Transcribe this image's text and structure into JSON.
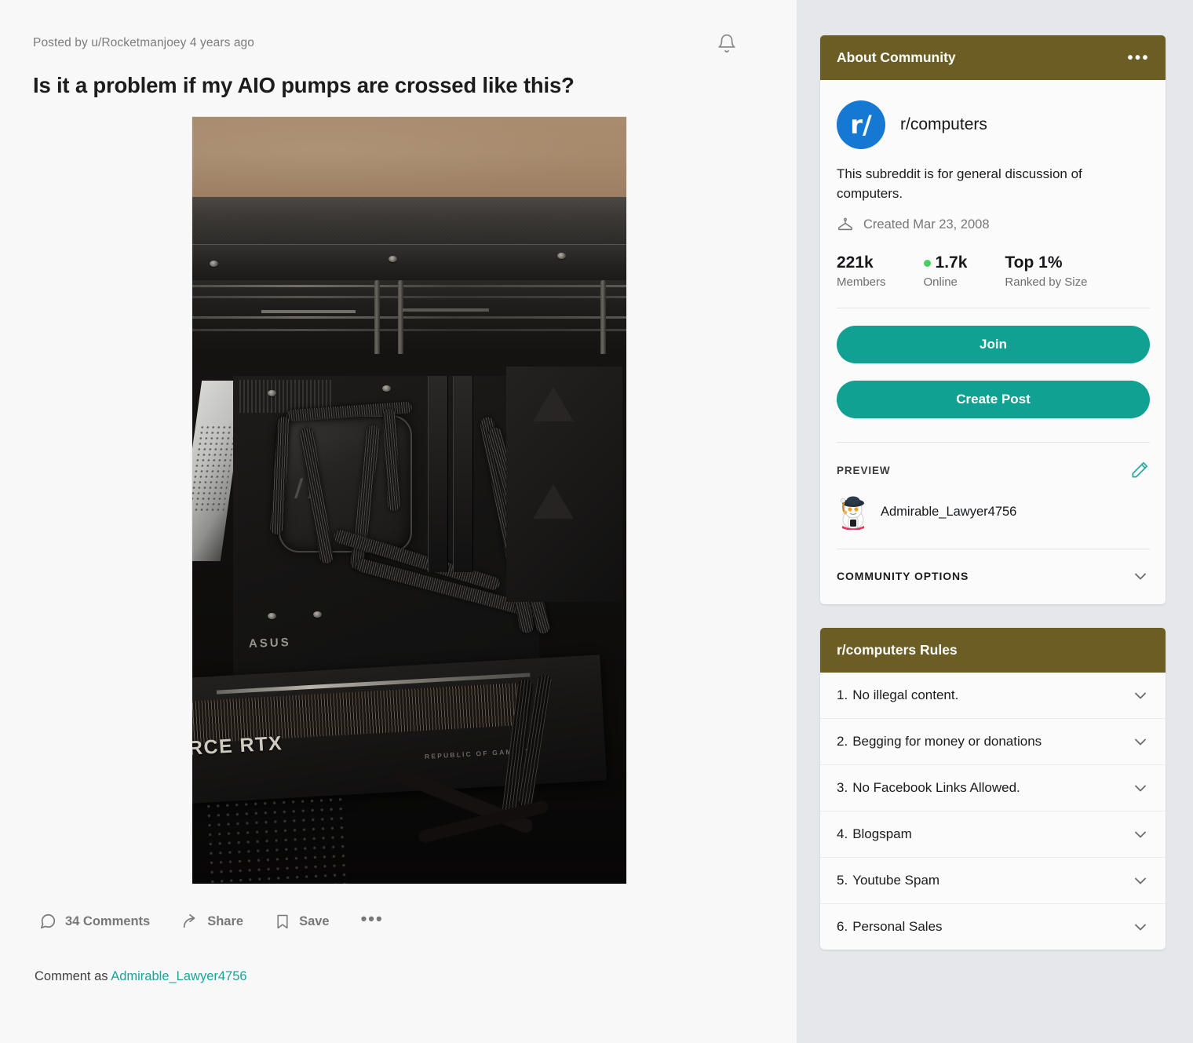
{
  "post": {
    "byline": "Posted by u/Rocketmanjoey 4 years ago",
    "title": "Is it a problem if my AIO pumps are crossed like this?",
    "notify_icon": "bell-icon",
    "image_alt": "Inside of a PC case showing AIO pump tubes crossed over the CPU block, ASUS ROG motherboard and GeForce RTX graphics card",
    "image_labels": {
      "gpu": "RCE RTX",
      "gpu_sub": "REPUBLIC OF GAMERS",
      "mobo_brand": "ASUS"
    },
    "actions": [
      {
        "label": "34 Comments",
        "icon": "comment-bubble-icon",
        "name": "comments-button"
      },
      {
        "label": "Share",
        "icon": "share-arrow-icon",
        "name": "share-button"
      },
      {
        "label": "Save",
        "icon": "bookmark-icon",
        "name": "save-button"
      },
      {
        "label": "•••",
        "icon": "more-dots-icon",
        "name": "more-options-button"
      }
    ],
    "comment_as_prefix": "Comment as ",
    "comment_as_user": "Admirable_Lawyer4756"
  },
  "about_community": {
    "header": "About Community",
    "header_menu_icon": "more-dots-icon",
    "avatar_text": "r/",
    "community_name": "r/computers",
    "description": "This subreddit is for general discussion of computers.",
    "created_icon": "cake-icon",
    "created": "Created Mar 23, 2008",
    "stats": [
      {
        "value": "221k",
        "label": "Members",
        "online": false
      },
      {
        "value": "1.7k",
        "label": "Online",
        "online": true
      },
      {
        "value": "Top 1%",
        "label": "Ranked by Size",
        "online": false
      }
    ],
    "join_label": "Join",
    "create_post_label": "Create Post",
    "preview_label": "PREVIEW",
    "preview_edit_icon": "pencil-icon",
    "preview_user": "Admirable_Lawyer4756",
    "community_options_label": "COMMUNITY OPTIONS",
    "community_options_chevron": "chevron-down-icon"
  },
  "rules": {
    "header": "r/computers Rules",
    "items": [
      {
        "num": "1.",
        "text": "No illegal content."
      },
      {
        "num": "2.",
        "text": "Begging for money or donations"
      },
      {
        "num": "3.",
        "text": "No Facebook Links Allowed."
      },
      {
        "num": "4.",
        "text": "Blogspam"
      },
      {
        "num": "5.",
        "text": "Youtube Spam"
      },
      {
        "num": "6.",
        "text": "Personal Sales"
      }
    ]
  },
  "colors": {
    "header_olive": "#6b5d23",
    "accent_teal": "#10a193",
    "link_teal": "#1aa39a",
    "avatar_blue": "#1578d3",
    "online_green": "#46d160",
    "sidebar_bg": "#e5e7ea",
    "page_bg": "#f8f8f9"
  }
}
